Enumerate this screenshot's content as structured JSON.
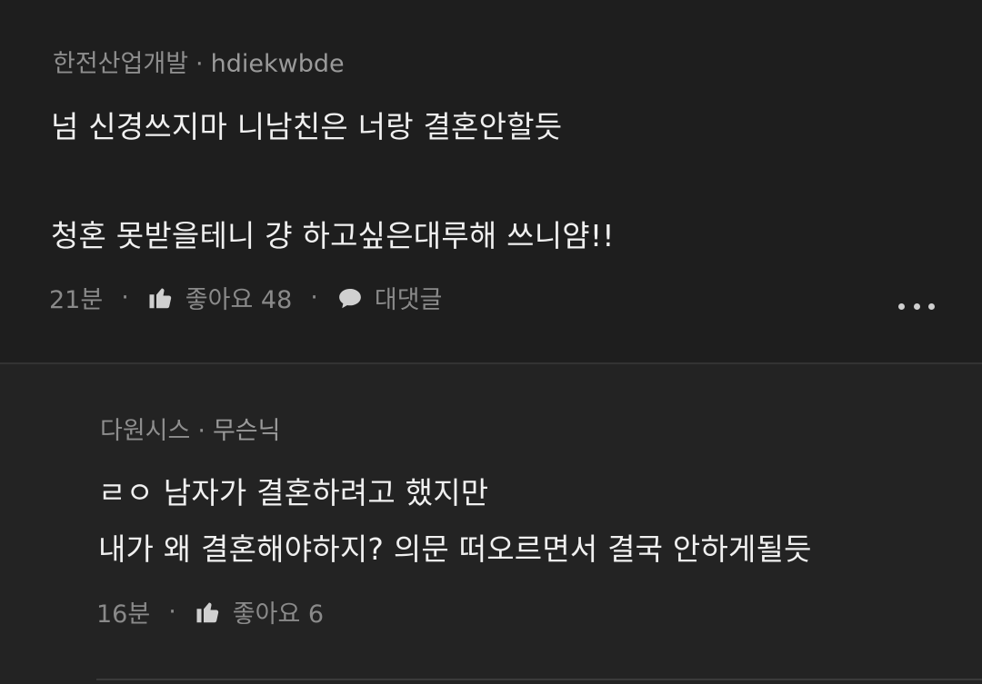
{
  "comment1": {
    "company": "한전산업개발",
    "separator": "·",
    "username": "hdiekwbde",
    "lines": [
      "넘 신경쓰지마 니남친은 너랑 결혼안할듯",
      "청혼 못받을테니 걍 하고싶은대루해 쓰니얌!!"
    ],
    "time": "21분",
    "like_label": "좋아요 48",
    "reply_label": "대댓글",
    "icons": {
      "like": "thumbs-up-icon",
      "reply": "speech-bubble-icon",
      "more": "more-dots-icon"
    }
  },
  "comment2": {
    "company": "다원시스",
    "separator": "·",
    "username": "무슨닉",
    "lines": [
      "ㄹㅇ 남자가 결혼하려고 했지만",
      "내가 왜 결혼해야하지? 의문 떠오르면서 결국 안하게될듯"
    ],
    "time": "16분",
    "like_label": "좋아요 6",
    "icons": {
      "like": "thumbs-up-icon"
    }
  },
  "footer_dot": "·",
  "colors": {
    "background": "#1e1e1e",
    "reply_background": "#232323",
    "text": "#f0f0f0",
    "muted": "#8e8e8e"
  }
}
